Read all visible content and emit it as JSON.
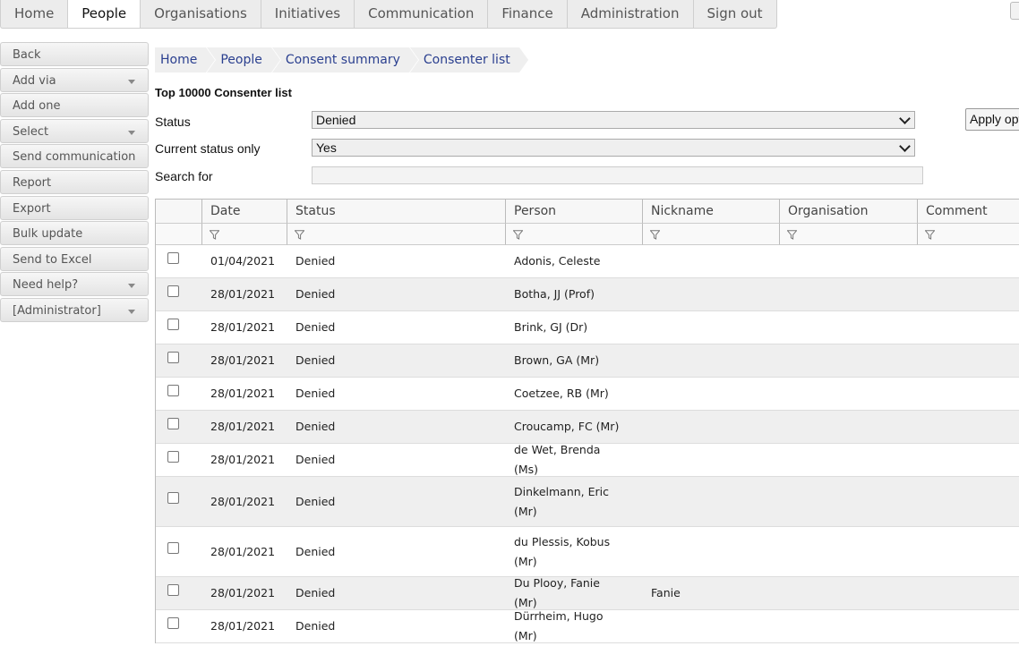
{
  "nav": {
    "tabs": [
      "Home",
      "People",
      "Organisations",
      "Initiatives",
      "Communication",
      "Finance",
      "Administration",
      "Sign out"
    ],
    "active": "People"
  },
  "sidemenu": {
    "items": [
      {
        "label": "Back",
        "dropdown": false
      },
      {
        "label": "Add via",
        "dropdown": true
      },
      {
        "label": "Add one",
        "dropdown": false
      },
      {
        "label": "Select",
        "dropdown": true
      },
      {
        "label": "Send communication",
        "dropdown": false
      },
      {
        "label": "Report",
        "dropdown": false
      },
      {
        "label": "Export",
        "dropdown": false
      },
      {
        "label": "Bulk update",
        "dropdown": false
      },
      {
        "label": "Send to Excel",
        "dropdown": false
      },
      {
        "label": "Need help?",
        "dropdown": true
      },
      {
        "label": "[Administrator]",
        "dropdown": true
      }
    ]
  },
  "breadcrumb": [
    "Home",
    "People",
    "Consent summary",
    "Consenter list"
  ],
  "list_title": "Top 10000 Consenter list",
  "form": {
    "status_label": "Status",
    "status_value": "Denied",
    "current_label": "Current status only",
    "current_value": "Yes",
    "search_label": "Search for",
    "search_value": "",
    "apply_label": "Apply options"
  },
  "table": {
    "columns": [
      "",
      "Date",
      "Status",
      "Person",
      "Nickname",
      "Organisation",
      "Comment"
    ],
    "rows": [
      {
        "date": "01/04/2021",
        "status": "Denied",
        "person": "Adonis, Celeste",
        "nickname": "",
        "organisation": "",
        "comment": ""
      },
      {
        "date": "28/01/2021",
        "status": "Denied",
        "person": "Botha, JJ (Prof)",
        "nickname": "",
        "organisation": "",
        "comment": ""
      },
      {
        "date": "28/01/2021",
        "status": "Denied",
        "person": "Brink, GJ (Dr)",
        "nickname": "",
        "organisation": "",
        "comment": ""
      },
      {
        "date": "28/01/2021",
        "status": "Denied",
        "person": "Brown, GA (Mr)",
        "nickname": "",
        "organisation": "",
        "comment": ""
      },
      {
        "date": "28/01/2021",
        "status": "Denied",
        "person": "Coetzee, RB (Mr)",
        "nickname": "",
        "organisation": "",
        "comment": ""
      },
      {
        "date": "28/01/2021",
        "status": "Denied",
        "person": "Croucamp, FC (Mr)",
        "nickname": "",
        "organisation": "",
        "comment": ""
      },
      {
        "date": "28/01/2021",
        "status": "Denied",
        "person": "de Wet, Brenda (Ms)",
        "nickname": "",
        "organisation": "",
        "comment": ""
      },
      {
        "date": "28/01/2021",
        "status": "Denied",
        "person": "Dinkelmann, Eric (Mr)",
        "nickname": "",
        "organisation": "",
        "comment": ""
      },
      {
        "date": "28/01/2021",
        "status": "Denied",
        "person": "du Plessis, Kobus (Mr)",
        "nickname": "",
        "organisation": "",
        "comment": ""
      },
      {
        "date": "28/01/2021",
        "status": "Denied",
        "person": "Du Plooy, Fanie (Mr)",
        "nickname": "Fanie",
        "organisation": "",
        "comment": ""
      },
      {
        "date": "28/01/2021",
        "status": "Denied",
        "person": "Dürrheim, Hugo (Mr)",
        "nickname": "",
        "organisation": "",
        "comment": ""
      }
    ]
  }
}
